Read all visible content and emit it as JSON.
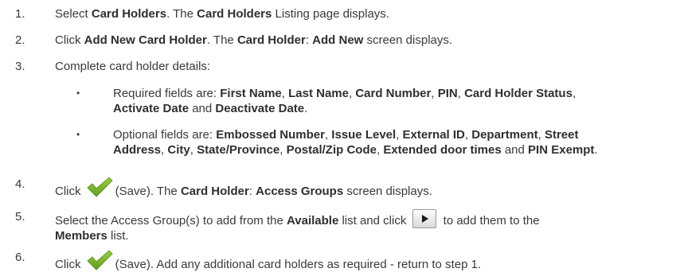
{
  "steps": [
    {
      "num": "1.",
      "a": "Select ",
      "b1": "Card Holders",
      "c": ". The ",
      "b2": "Card Holders",
      "d": " Listing page displays."
    },
    {
      "num": "2.",
      "a": "Click ",
      "b1": "Add New Card Holder",
      "c": ". The ",
      "b2": "Card Holder",
      "d": ": ",
      "b3": "Add New",
      "e": " screen displays."
    },
    {
      "num": "3.",
      "text": "Complete card holder details:"
    },
    {
      "num": "4.",
      "a": "Click ",
      "b": "(Save). The ",
      "b1": "Card Holder",
      "c": ": ",
      "b2": "Access Groups",
      "d": " screen displays."
    },
    {
      "num": "5.",
      "a": "Select the Access Group(s) to add from the ",
      "b1": "Available",
      "c": " list and click ",
      "d": " to add them to the",
      "b2": "Members",
      "e": " list."
    },
    {
      "num": "6.",
      "a": "Click ",
      "b": "(Save). Add any additional card holders as required - return to step 1."
    }
  ],
  "required": {
    "bullet": "•",
    "prefix": "Required fields are: ",
    "f1": "First Name",
    "f2": "Last Name",
    "f3": "Card Number",
    "f4": "PIN",
    "f5": "Card Holder Status",
    "f6": "Activate Date",
    "and": " and ",
    "f7": "Deactivate Date",
    "end": "."
  },
  "optional": {
    "bullet": "•",
    "prefix": "Optional fields are: ",
    "f1": "Embossed Number",
    "f2": "Issue Level",
    "f3": "External ID",
    "f4": "Department",
    "f5": "Street",
    "f6": "Address",
    "f7": "City",
    "f8": "State/Province",
    "f9": "Postal/Zip Code",
    "f10": "Extended door times",
    "and": " and ",
    "f11": "PIN Exempt",
    "end": "."
  },
  "sep": ", ",
  "icons": {
    "save": "checkmark-save-icon",
    "add": "play-arrow-icon"
  },
  "colors": {
    "check": "#7ab828",
    "text": "#3a3a3a"
  }
}
